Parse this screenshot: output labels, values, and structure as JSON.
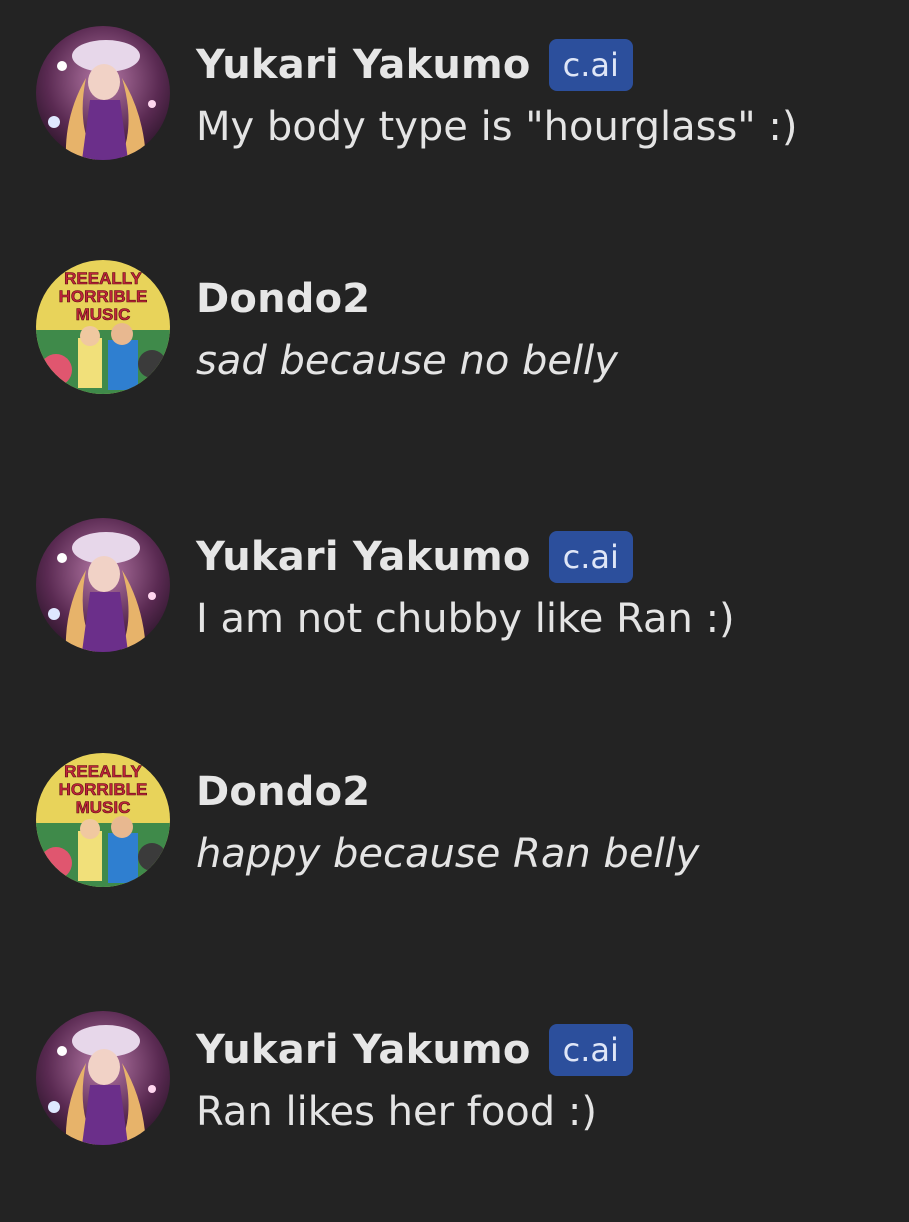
{
  "messages": [
    {
      "author": "Yukari Yakumo",
      "badge": "c.ai",
      "text": "My body type is \"hourglass\" :)",
      "italic": false,
      "avatar": "yukari-avatar"
    },
    {
      "author": "Dondo2",
      "badge": "",
      "text": "sad because no belly",
      "italic": true,
      "avatar": "dondo-avatar",
      "avatar_caption": [
        "REEALLY",
        "HORRIBLE",
        "MUSIC"
      ]
    },
    {
      "author": "Yukari Yakumo",
      "badge": "c.ai",
      "text": "I am not chubby like Ran :)",
      "italic": false,
      "avatar": "yukari-avatar"
    },
    {
      "author": "Dondo2",
      "badge": "",
      "text": "happy because Ran belly",
      "italic": true,
      "avatar": "dondo-avatar",
      "avatar_caption": [
        "REEALLY",
        "HORRIBLE",
        "MUSIC"
      ]
    },
    {
      "author": "Yukari Yakumo",
      "badge": "c.ai",
      "text": "Ran likes her food :)",
      "italic": false,
      "avatar": "yukari-avatar"
    }
  ],
  "colors": {
    "background": "#232323",
    "badge_bg": "#2c4f9c",
    "text": "#e4e4e4"
  }
}
